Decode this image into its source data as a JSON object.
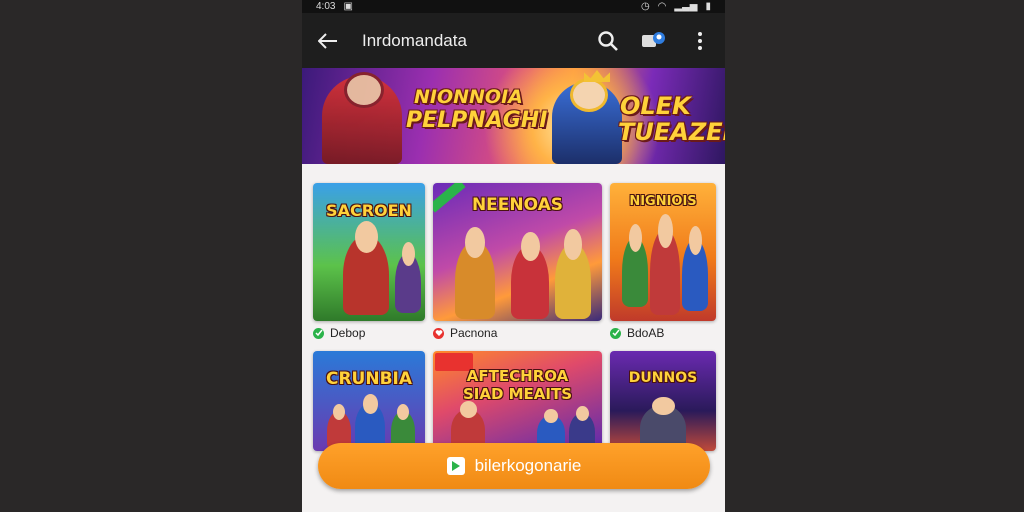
{
  "status_bar": {
    "time": "4:03"
  },
  "app_bar": {
    "title": "Inrdomandata",
    "icons": [
      "back-arrow-icon",
      "search-icon",
      "profile-badge-icon",
      "more-vert-icon"
    ]
  },
  "banner": {
    "title_line1": "NIONNOIA",
    "title_line2": "PELPNAGHI",
    "title_right_line1": "OLEK",
    "title_right_line2": "TUEAZEI"
  },
  "games": [
    {
      "title": "SACROEN",
      "label": "Debop",
      "badge_color": "#2bb34a",
      "ribbon": false,
      "tag": false
    },
    {
      "title": "NEENOAS",
      "label": "Pacnona",
      "badge_color": "#e8322f",
      "ribbon": true,
      "tag": false
    },
    {
      "title": "NIGNIOIS",
      "label": "BdoAB",
      "badge_color": "#2bb34a",
      "ribbon": false,
      "tag": false
    },
    {
      "title": "CRUNBIA",
      "label": "",
      "badge_color": "",
      "ribbon": false,
      "tag": false
    },
    {
      "title_line1": "AFTECHROA",
      "title_line2": "SIAD MEAITS",
      "label": "",
      "badge_color": "",
      "ribbon": false,
      "tag": true
    },
    {
      "title": "DUNNOS",
      "label": "",
      "badge_color": "",
      "ribbon": false,
      "tag": false
    }
  ],
  "cta": {
    "label": "bilerkogonarie",
    "icon": "play-store-icon",
    "color": "#f08a14"
  }
}
